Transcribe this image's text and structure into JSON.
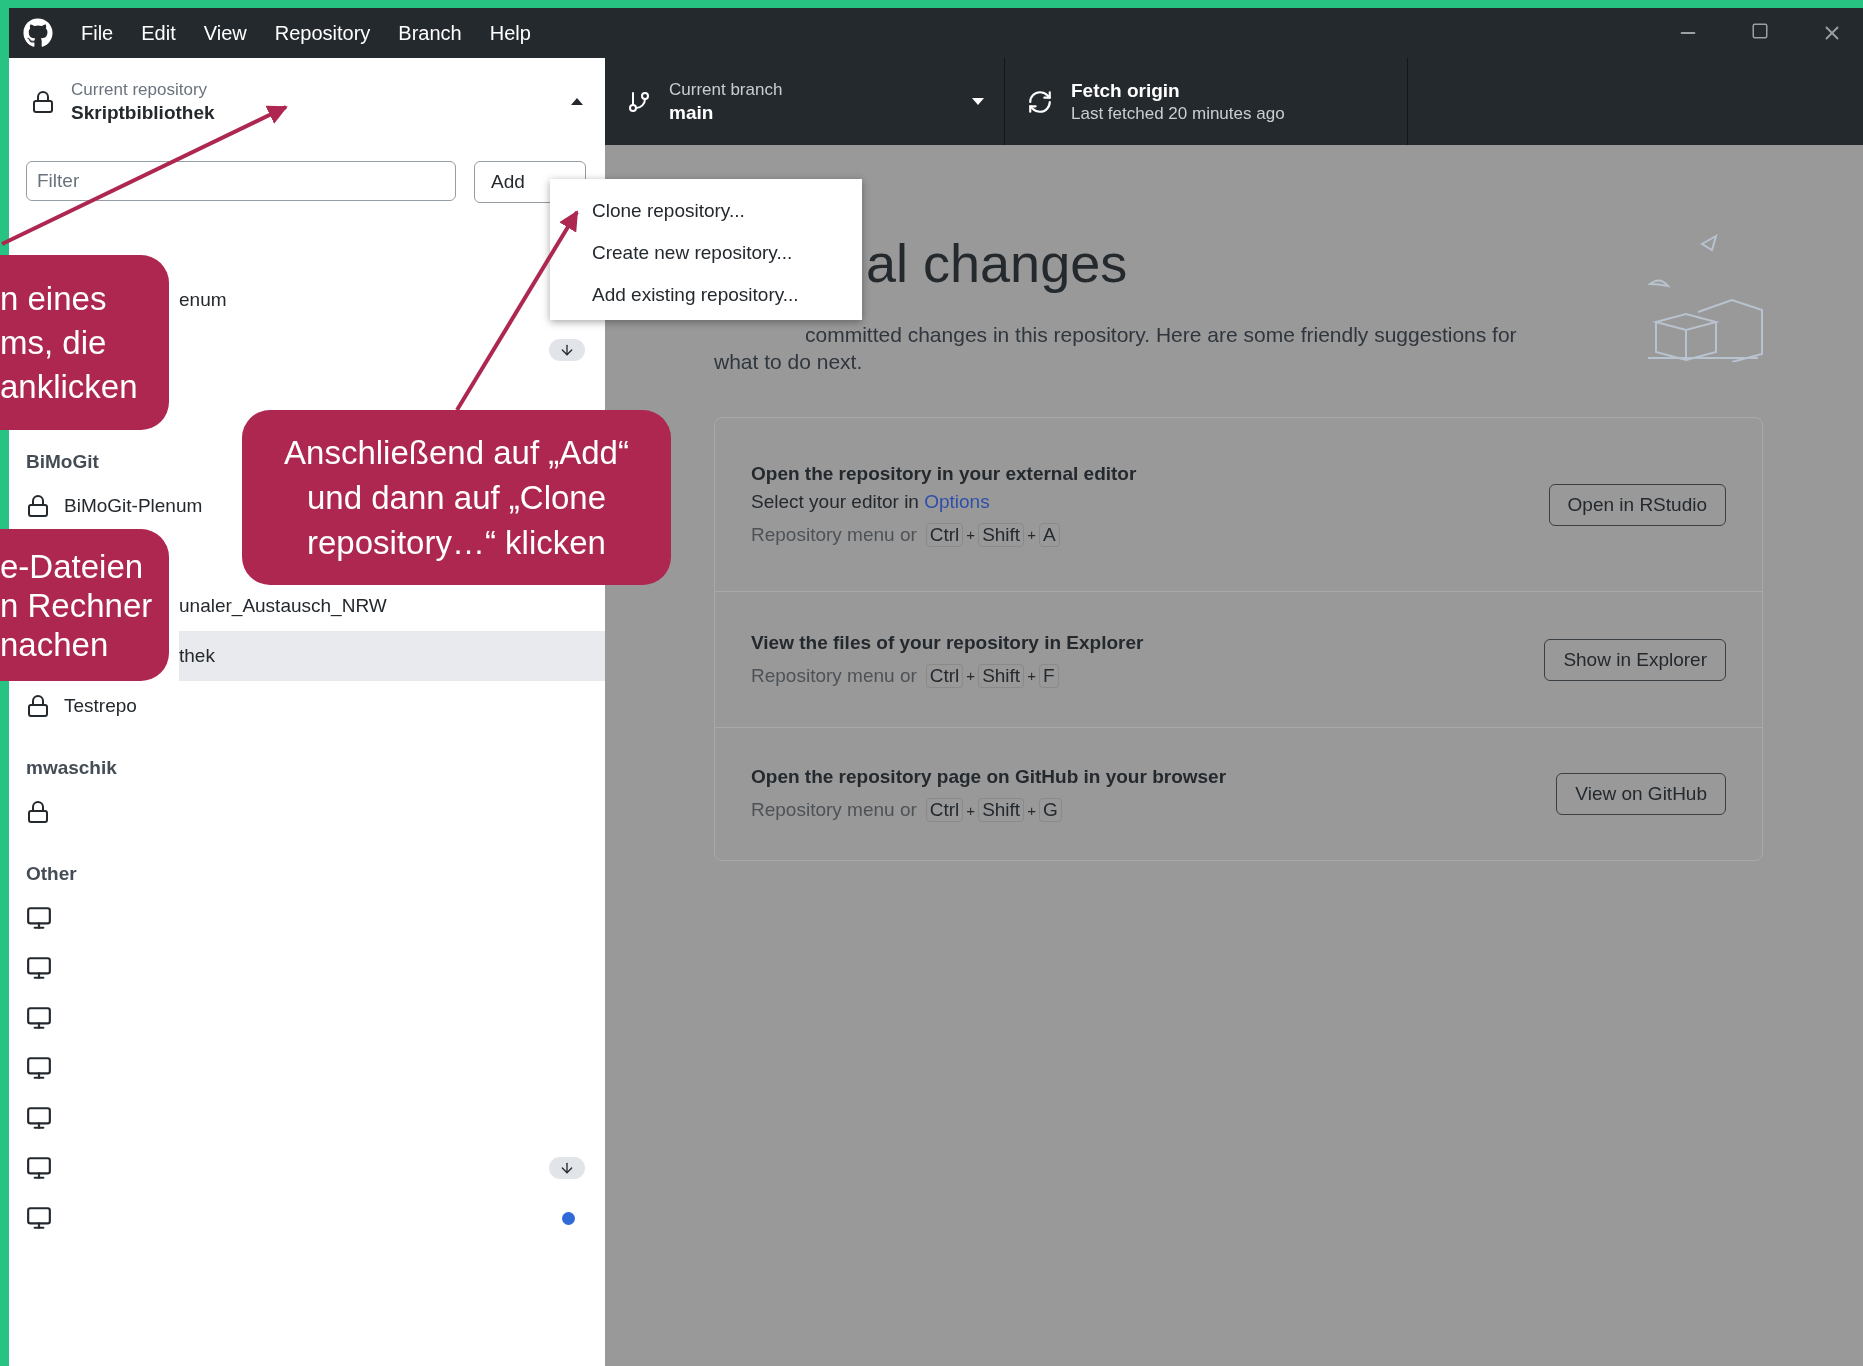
{
  "menu_bar": {
    "items": [
      "File",
      "Edit",
      "View",
      "Repository",
      "Branch",
      "Help"
    ]
  },
  "repository_selector": {
    "label": "Current repository",
    "value": "Skriptbibliothek",
    "expanded": true
  },
  "branch_selector": {
    "label": "Current branch",
    "value": "main"
  },
  "fetch": {
    "label": "Fetch origin",
    "detail": "Last fetched 20 minutes ago"
  },
  "repo_list": {
    "filter_placeholder": "Filter",
    "add_button": "Add",
    "groups": [
      {
        "items": [
          {
            "name": "enum",
            "kind": "none",
            "selected": false,
            "behind": false,
            "changes": false
          },
          {
            "kind": "none",
            "selected": false,
            "behind": true,
            "changes": false
          },
          {
            "kind": "none",
            "selected": false,
            "behind": false,
            "changes": false
          }
        ]
      },
      {
        "title": "BiMoGit",
        "items": [
          {
            "name": "BiMoGit-Plenum",
            "kind": "lock",
            "selected": false,
            "behind": false,
            "changes": false
          },
          {
            "kind": "none",
            "selected": false,
            "behind": false,
            "changes": false
          },
          {
            "name": "unaler_Austausch_NRW",
            "kind": "none",
            "selected": false,
            "behind": false,
            "changes": false
          },
          {
            "name": "thek",
            "kind": "none",
            "selected": true,
            "behind": false,
            "changes": false
          },
          {
            "name": "Testrepo",
            "kind": "lock",
            "selected": false,
            "behind": false,
            "changes": false
          }
        ]
      },
      {
        "title": "mwaschik",
        "items": [
          {
            "kind": "lock",
            "selected": false,
            "behind": false,
            "changes": false
          }
        ]
      },
      {
        "title": "Other",
        "items": [
          {
            "kind": "monitor",
            "selected": false,
            "behind": false,
            "changes": false
          },
          {
            "kind": "monitor",
            "selected": false,
            "behind": false,
            "changes": false
          },
          {
            "kind": "monitor",
            "selected": false,
            "behind": false,
            "changes": false
          },
          {
            "kind": "monitor",
            "selected": false,
            "behind": false,
            "changes": false
          },
          {
            "kind": "monitor",
            "selected": false,
            "behind": false,
            "changes": false
          },
          {
            "kind": "monitor",
            "selected": false,
            "behind": true,
            "changes": false
          },
          {
            "kind": "monitor",
            "selected": false,
            "behind": false,
            "changes": true
          }
        ]
      }
    ]
  },
  "add_menu": {
    "items": [
      "Clone repository...",
      "Create new repository...",
      "Add existing repository..."
    ]
  },
  "changes_view": {
    "heading": "al changes",
    "description": "committed changes in this repository. Here are some friendly suggestions for what to do next.",
    "suggestions": [
      {
        "title": "Open the repository in your external editor",
        "detail": {
          "text": "Select your editor in",
          "link": "Options"
        },
        "shortcut_prefix": "Repository menu or",
        "shortcut": [
          {
            "kind": "key",
            "text": "Ctrl"
          },
          {
            "kind": "plus",
            "text": "+"
          },
          {
            "kind": "key",
            "text": "Shift"
          },
          {
            "kind": "plus",
            "text": "+"
          },
          {
            "kind": "key",
            "text": "A"
          }
        ],
        "button": "Open in RStudio"
      },
      {
        "title": "View the files of your repository in Explorer",
        "shortcut_prefix": "Repository menu or",
        "shortcut": [
          {
            "kind": "key",
            "text": "Ctrl"
          },
          {
            "kind": "plus",
            "text": "+"
          },
          {
            "kind": "key",
            "text": "Shift"
          },
          {
            "kind": "plus",
            "text": "+"
          },
          {
            "kind": "key",
            "text": "F"
          }
        ],
        "button": "Show in Explorer"
      },
      {
        "title": "Open the repository page on GitHub in your browser",
        "shortcut_prefix": "Repository menu or",
        "shortcut": [
          {
            "kind": "key",
            "text": "Ctrl"
          },
          {
            "kind": "plus",
            "text": "+"
          },
          {
            "kind": "key",
            "text": "Shift"
          },
          {
            "kind": "plus",
            "text": "+"
          },
          {
            "kind": "key",
            "text": "G"
          }
        ],
        "button": "View on GitHub"
      }
    ]
  },
  "annotations": [
    {
      "text": "n eines\nms, die\nanklicken"
    },
    {
      "text": "e-Dateien\nn Rechner\nnachen"
    },
    {
      "text": "Anschließend auf „Add“\nund dann auf „Clone\nrepository…“ klicken"
    }
  ]
}
